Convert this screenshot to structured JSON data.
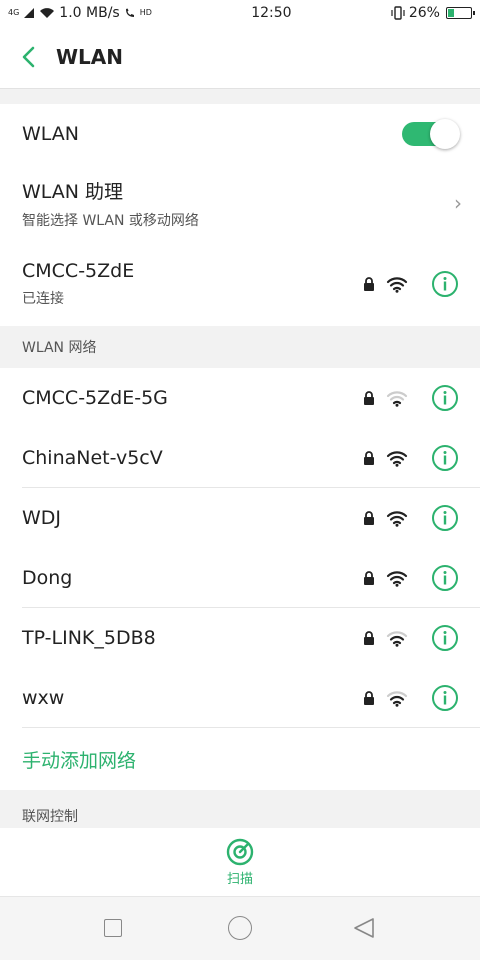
{
  "status_bar": {
    "signal_label": "4G",
    "net_speed": "1.0 MB/s",
    "hd_label": "HD",
    "time": "12:50",
    "battery_percent": "26%",
    "battery_level": 0.26
  },
  "header": {
    "title": "WLAN"
  },
  "wlan_toggle": {
    "label": "WLAN",
    "enabled": true
  },
  "wlan_assistant": {
    "title": "WLAN 助理",
    "subtitle": "智能选择 WLAN 或移动网络"
  },
  "connected": {
    "ssid": "CMCC-5ZdE",
    "status": "已连接"
  },
  "networks_header": "WLAN 网络",
  "networks": [
    {
      "ssid": "CMCC-5ZdE-5G",
      "secured": true,
      "signal": "weak"
    },
    {
      "ssid": "ChinaNet-v5cV",
      "secured": true,
      "signal": "strong"
    },
    {
      "ssid": "WDJ",
      "secured": true,
      "signal": "strong"
    },
    {
      "ssid": "Dong",
      "secured": true,
      "signal": "strong"
    },
    {
      "ssid": "TP-LINK_5DB8",
      "secured": true,
      "signal": "medium"
    },
    {
      "ssid": "wxw",
      "secured": true,
      "signal": "medium"
    }
  ],
  "add_network": "手动添加网络",
  "network_control_header": "联网控制",
  "scan_label": "扫描",
  "colors": {
    "accent": "#2cb26e",
    "section_bg": "#f2f2f2"
  },
  "icons": {
    "back": "back-arrow-icon",
    "lock": "lock-icon",
    "wifi": "wifi-signal-icon",
    "info": "info-icon",
    "scan": "scan-radar-icon"
  }
}
